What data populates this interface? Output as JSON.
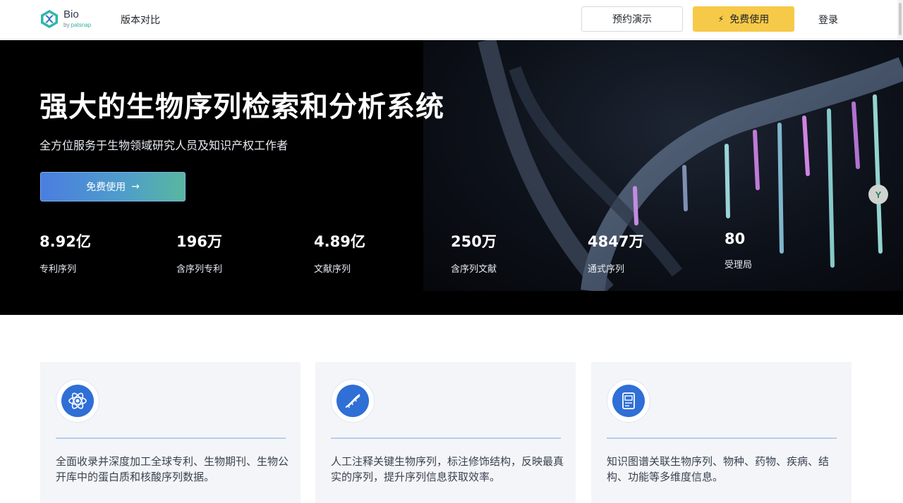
{
  "header": {
    "logo_text": "Bio",
    "logo_sub_prefix": "by ",
    "logo_sub_brand": "patsnap",
    "nav_compare": "版本对比",
    "demo_label": "预约演示",
    "free_label": "免费使用",
    "login_label": "登录"
  },
  "hero": {
    "title": "强大的生物序列检索和分析系统",
    "subtitle": "全方位服务于生物领域研究人员及知识产权工作者",
    "cta_label": "免费使用",
    "cta_arrow": "→",
    "badge": "Y",
    "stats": [
      {
        "value": "8.92亿",
        "label": "专利序列"
      },
      {
        "value": "196万",
        "label": "含序列专利"
      },
      {
        "value": "4.89亿",
        "label": "文献序列"
      },
      {
        "value": "250万",
        "label": "含序列文献"
      },
      {
        "value": "4847万",
        "label": "通式序列"
      },
      {
        "value": "80",
        "label": "受理局"
      }
    ]
  },
  "features": [
    {
      "icon": "atom-icon",
      "text": "全面收录并深度加工全球专利、生物期刊、生物公开库中的蛋白质和核酸序列数据。"
    },
    {
      "icon": "dna-icon",
      "text": "人工注释关键生物序列，标注修饰结构，反映最真实的序列，提升序列信息获取效率。"
    },
    {
      "icon": "database-icon",
      "text": "知识图谱关联生物序列、物种、药物、疾病、结构、功能等多维度信息。"
    }
  ],
  "colors": {
    "accent_yellow": "#f7c948",
    "accent_blue": "#2f6fd6",
    "hero_bg": "#000000"
  }
}
